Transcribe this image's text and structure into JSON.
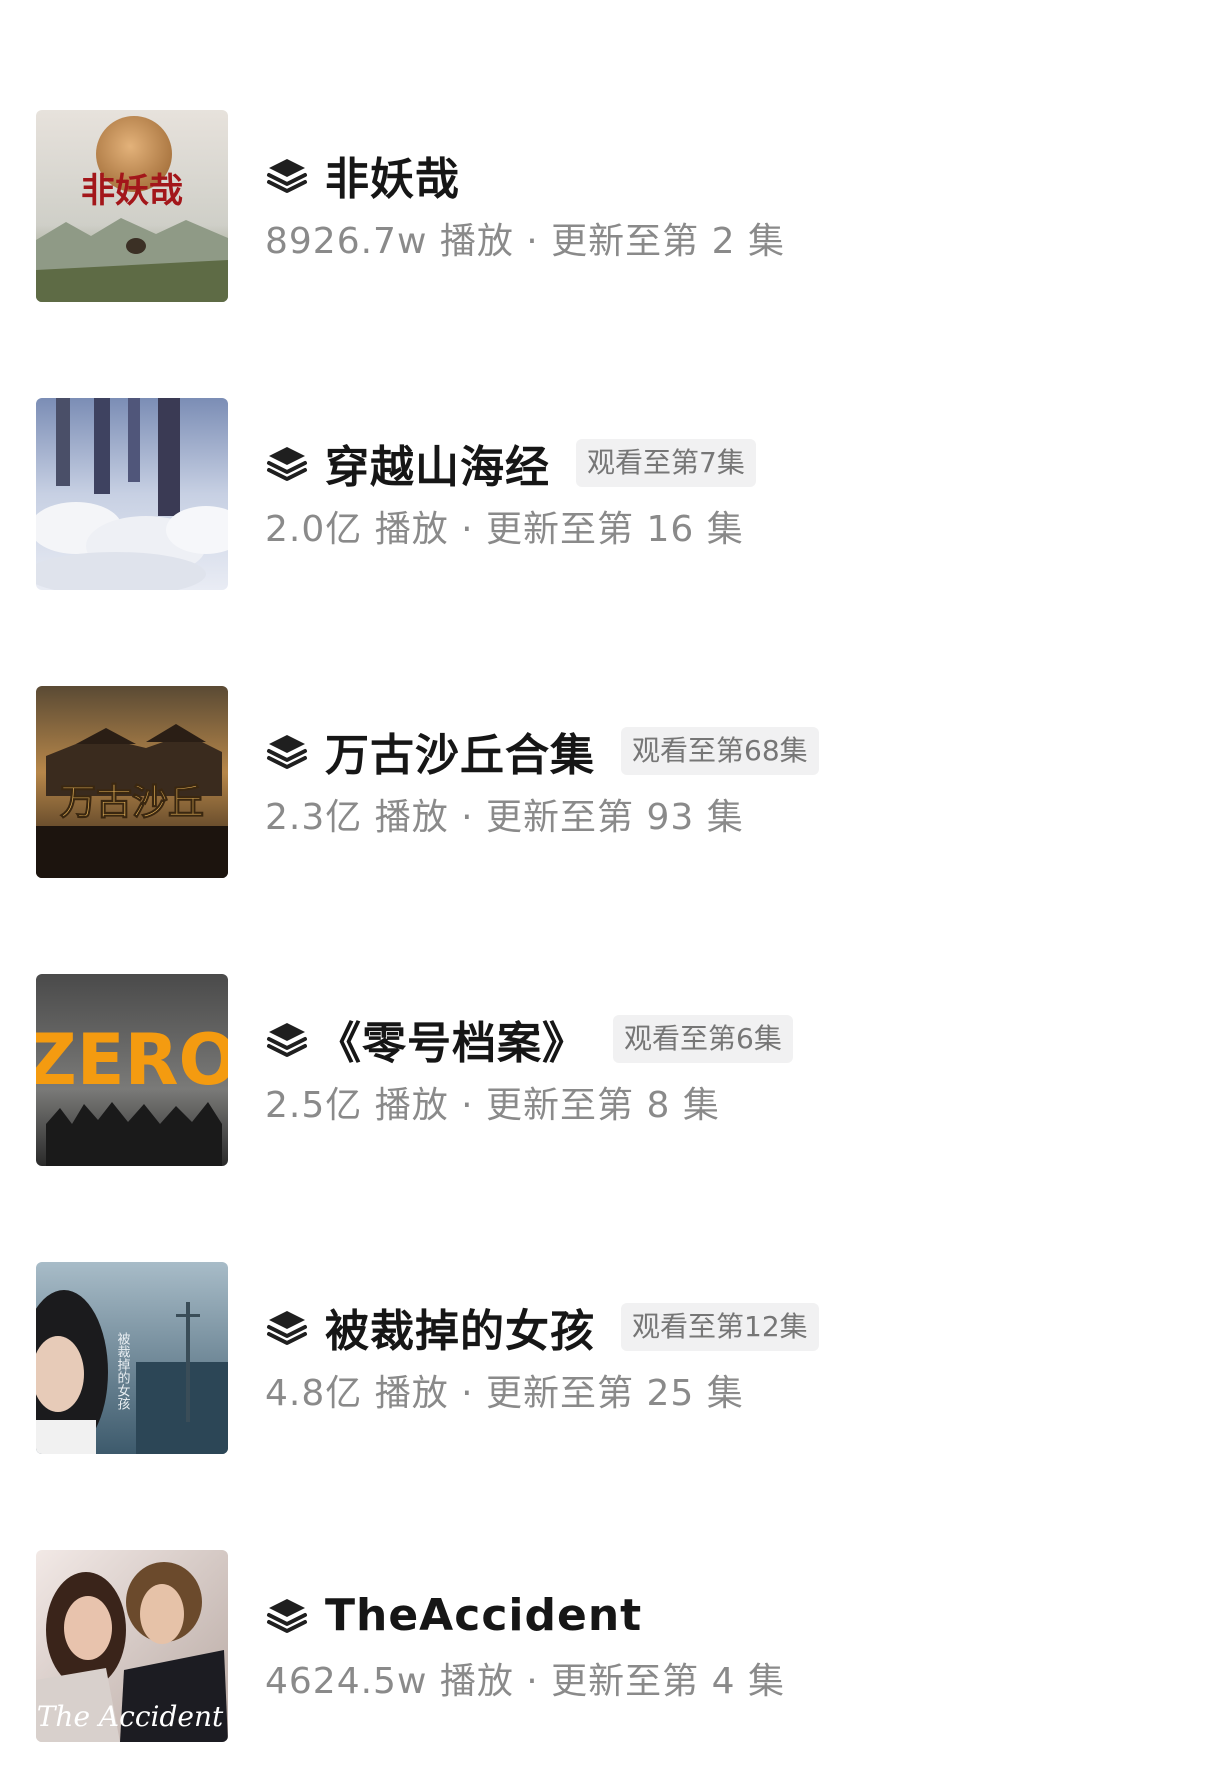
{
  "colors": {
    "title": "#161616",
    "meta": "#8a8a8a",
    "badge_bg": "#f1f1f2",
    "badge_text": "#767676"
  },
  "items": [
    {
      "title": "非妖哉",
      "badge": "",
      "meta": "8926.7w 播放 · 更新至第 2 集",
      "icon": "stack-layers-icon",
      "poster_text": "非妖哉"
    },
    {
      "title": "穿越山海经",
      "badge": "观看至第7集",
      "meta": "2.0亿 播放 · 更新至第 16 集",
      "icon": "stack-layers-icon",
      "poster_text": ""
    },
    {
      "title": "万古沙丘合集",
      "badge": "观看至第68集",
      "meta": "2.3亿 播放 · 更新至第 93 集",
      "icon": "stack-layers-icon",
      "poster_text": "万古沙丘"
    },
    {
      "title": "《零号档案》",
      "badge": "观看至第6集",
      "meta": "2.5亿 播放 · 更新至第 8 集",
      "icon": "stack-layers-icon",
      "poster_text": "ZERO"
    },
    {
      "title": "被裁掉的女孩",
      "badge": "观看至第12集",
      "meta": "4.8亿 播放 · 更新至第 25 集",
      "icon": "stack-layers-icon",
      "poster_text": "被裁掉的女孩"
    },
    {
      "title": "TheAccident",
      "badge": "",
      "meta": "4624.5w 播放 · 更新至第 4 集",
      "icon": "stack-layers-icon",
      "poster_text": "The Accident"
    }
  ]
}
